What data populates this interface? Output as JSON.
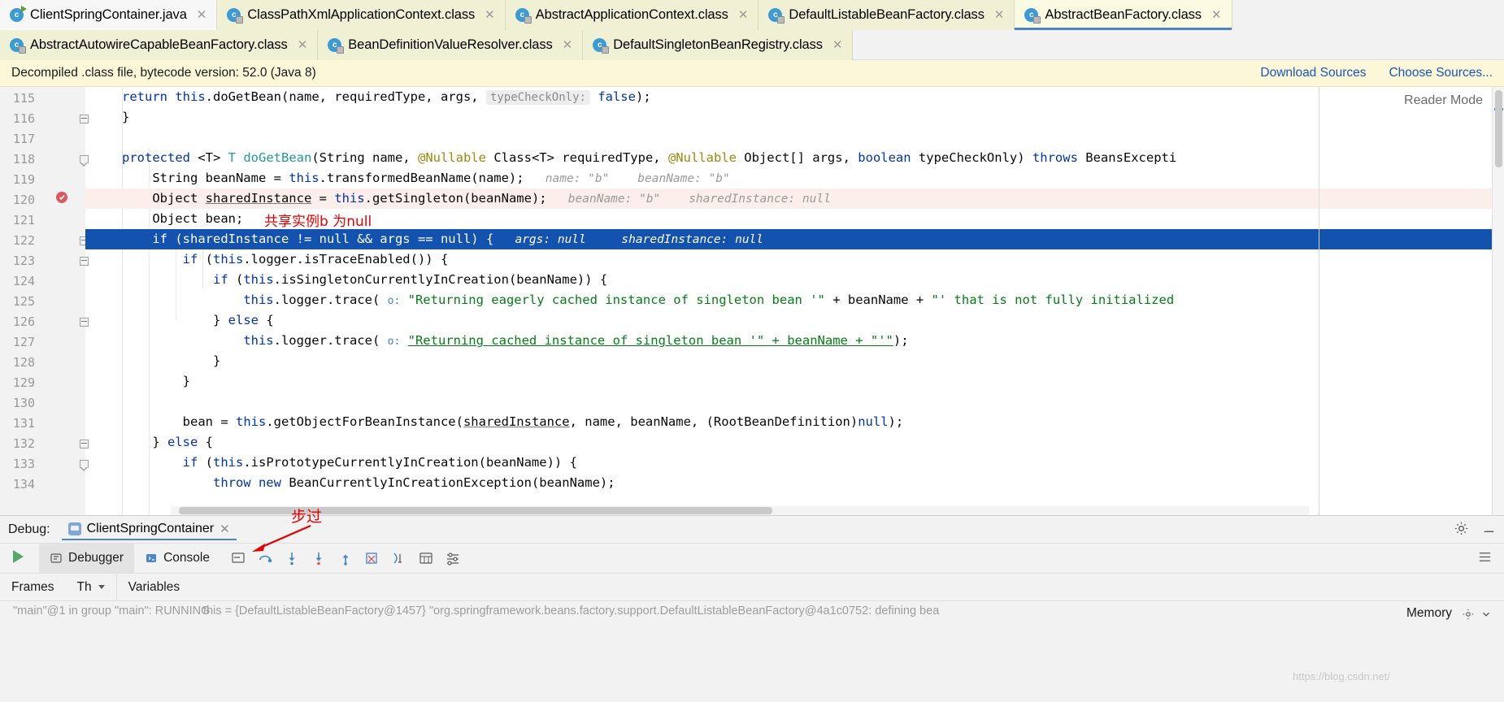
{
  "tabs_row1": [
    {
      "label": "ClientSpringContainer.java",
      "icon": "java-class-run-icon",
      "state": "plain",
      "active": false
    },
    {
      "label": "ClassPathXmlApplicationContext.class",
      "icon": "class-file-icon",
      "state": "class",
      "active": false
    },
    {
      "label": "AbstractApplicationContext.class",
      "icon": "class-file-icon",
      "state": "class",
      "active": false
    },
    {
      "label": "DefaultListableBeanFactory.class",
      "icon": "class-file-icon",
      "state": "class",
      "active": false
    },
    {
      "label": "AbstractBeanFactory.class",
      "icon": "class-file-icon",
      "state": "class",
      "active": true
    }
  ],
  "tabs_row2": [
    {
      "label": "AbstractAutowireCapableBeanFactory.class",
      "icon": "class-file-icon",
      "state": "class",
      "active": false
    },
    {
      "label": "BeanDefinitionValueResolver.class",
      "icon": "class-file-icon",
      "state": "class",
      "active": false
    },
    {
      "label": "DefaultSingletonBeanRegistry.class",
      "icon": "class-file-icon",
      "state": "class",
      "active": false
    }
  ],
  "notification": {
    "message": "Decompiled .class file, bytecode version: 52.0 (Java 8)",
    "download_sources": "Download Sources",
    "choose_sources": "Choose Sources..."
  },
  "editor": {
    "reader_mode": "Reader Mode",
    "first_line": 115,
    "lines": [
      {
        "n": 115,
        "state": "normal",
        "indent": 0
      },
      {
        "n": 116,
        "state": "normal",
        "fold": "box"
      },
      {
        "n": 117,
        "state": "normal"
      },
      {
        "n": 118,
        "state": "normal",
        "fold": "arrow"
      },
      {
        "n": 119,
        "state": "normal"
      },
      {
        "n": 120,
        "state": "exec",
        "breakpoint": true
      },
      {
        "n": 121,
        "state": "normal"
      },
      {
        "n": 122,
        "state": "selected",
        "fold": "box"
      },
      {
        "n": 123,
        "state": "normal",
        "fold": "box"
      },
      {
        "n": 124,
        "state": "normal"
      },
      {
        "n": 125,
        "state": "normal"
      },
      {
        "n": 126,
        "state": "normal",
        "fold": "box"
      },
      {
        "n": 127,
        "state": "normal"
      },
      {
        "n": 128,
        "state": "normal"
      },
      {
        "n": 129,
        "state": "normal"
      },
      {
        "n": 130,
        "state": "normal"
      },
      {
        "n": 131,
        "state": "normal"
      },
      {
        "n": 132,
        "state": "normal",
        "fold": "box"
      },
      {
        "n": 133,
        "state": "normal",
        "fold": "arrow"
      },
      {
        "n": 134,
        "state": "normal"
      }
    ],
    "annotation_shared_instance": "共享实例b 为null",
    "inline_hints": {
      "typeCheckOnly_label": "typeCheckOnly:",
      "typeCheckOnly_value": "false",
      "name_b": "name: \"b\"",
      "beanName_b": "beanName: \"b\"",
      "beanName_b2": "beanName: \"b\"",
      "sharedInstance_null": "sharedInstance: null",
      "args_null": "args: null",
      "sharedInstance_null2": "sharedInstance: null"
    }
  },
  "debug": {
    "label": "Debug:",
    "session_name": "ClientSpringContainer",
    "tabs": [
      {
        "label": "Debugger",
        "icon": "debugger-icon",
        "active": true
      },
      {
        "label": "Console",
        "icon": "console-icon",
        "active": false
      }
    ],
    "columns": [
      {
        "label": "Frames",
        "icon": "frames-icon"
      },
      {
        "label": "Th",
        "icon": "thread-filter-icon"
      },
      {
        "label": "Variables",
        "icon": "variables-icon"
      }
    ],
    "memory_label": "Memory",
    "annotation_step_over": "步过",
    "frame_text": "\"main\"@1 in group \"main\": RUNNING",
    "variables_text": "this = {DefaultListableBeanFactory@1457} \"org.springframework.beans.factory.support.DefaultListableBeanFactory@4a1c0752: defining bea"
  },
  "watermark": "https://blog.csdn.net/",
  "colors": {
    "accent": "#4a86c8",
    "tab_class_bg": "#eff0d4",
    "tab_active_bg": "#fbfbe4",
    "notification_bg": "#fcf7d9",
    "link": "#1a56b8",
    "exec_line": "#fceeea",
    "selected_line": "#1452b0",
    "keyword": "#0033b3",
    "type": "#20999d",
    "annotation_java": "#9e880d",
    "string": "#067d17",
    "annotation_red": "#e60000",
    "gutter_bg": "#f2f2f2",
    "line_number": "#999999"
  }
}
